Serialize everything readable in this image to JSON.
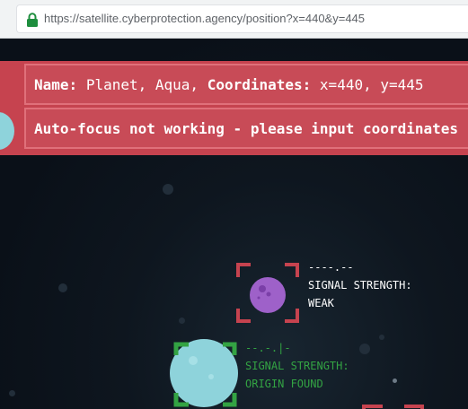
{
  "browser": {
    "url": "https://satellite.cyberprotection.agency/position?x=440&y=445"
  },
  "banner": {
    "name_label": "Name:",
    "name_value": "Planet, Aqua,",
    "coords_label": "Coordinates:",
    "coords_value": "x=440, y=445",
    "message": "Auto-focus not working - please input coordinates"
  },
  "targets": {
    "purple": {
      "signal_bars": "----.--",
      "label": "SIGNAL STRENGTH:",
      "status": "WEAK"
    },
    "aqua": {
      "signal_bars": "--.-.|-",
      "label": "SIGNAL STRENGTH:",
      "status": "ORIGIN FOUND"
    }
  },
  "colors": {
    "banner_bg": "#c6434f",
    "weak_bracket": "#c6434f",
    "origin_bracket": "#33a343",
    "space_bg": "#0b1119"
  },
  "icons": [
    "lock-icon",
    "planet-purple",
    "planet-aqua"
  ]
}
